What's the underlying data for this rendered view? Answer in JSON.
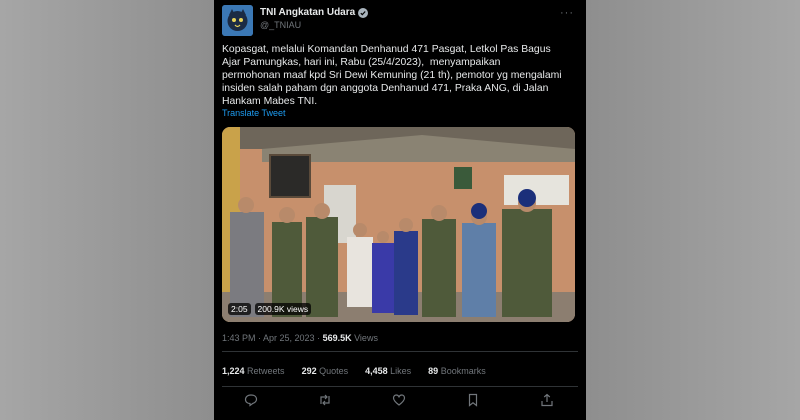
{
  "account": {
    "display_name": "TNI Angkatan Udara",
    "handle": "@_TNIAU"
  },
  "tweet": {
    "text": "Kopasgat, melalui Komandan Denhanud 471 Pasgat, Letkol Pas Bagus\nAjar Pamungkas, hari ini, Rabu (25/4/2023),  menyampaikan\npermohonan maaf kpd Sri Dewi Kemuning (21 th), pemotor yg mengalami\ninsiden salah paham dgn anggota Denhanud 471, Praka ANG, di Jalan\nHankam Mabes TNI.",
    "translate_label": "Translate Tweet",
    "video": {
      "duration": "2:05",
      "views": "200.9K views"
    },
    "timestamp": "1:43 PM · Apr 25, 2023 · ",
    "view_count": "569.5K",
    "views_label": " Views"
  },
  "stats": {
    "retweets_count": "1,224",
    "retweets_label": " Retweets",
    "quotes_count": "292",
    "quotes_label": " Quotes",
    "likes_count": "4,458",
    "likes_label": " Likes",
    "bookmarks_count": "89",
    "bookmarks_label": " Bookmarks"
  },
  "colors": {
    "background": "#000000",
    "text": "#e7e9ea",
    "muted": "#71767b",
    "link": "#1d9bf0",
    "divider": "#2f3336"
  },
  "icons": [
    "verified-badge-icon",
    "more-options-icon",
    "reply-icon",
    "retweet-icon",
    "like-icon",
    "bookmark-icon",
    "share-icon"
  ]
}
